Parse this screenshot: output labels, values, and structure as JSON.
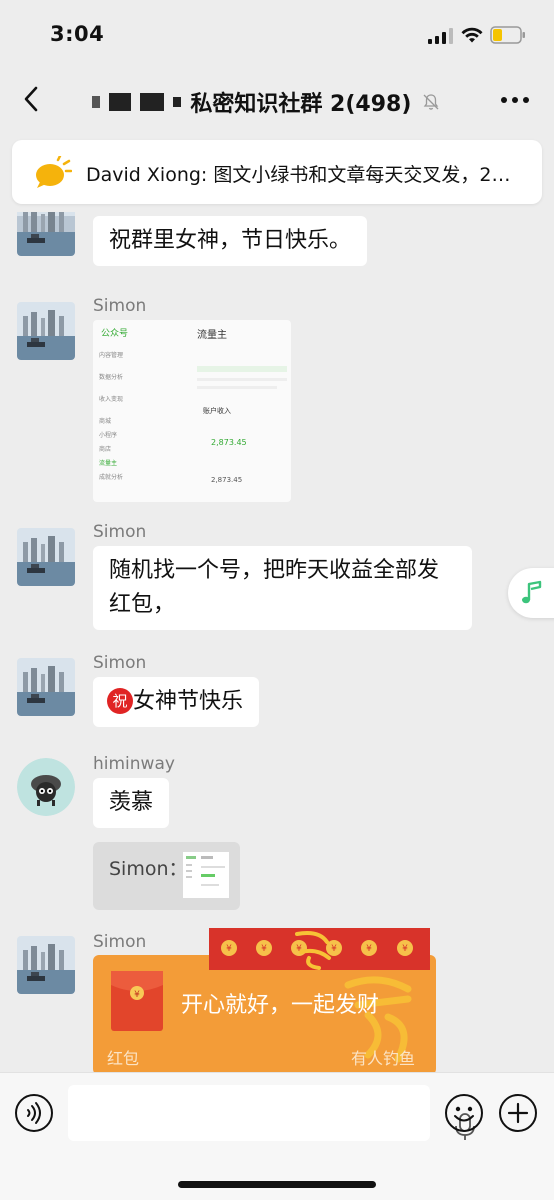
{
  "status_bar": {
    "time": "3:04"
  },
  "header": {
    "title": "私密知识社群 2(498)"
  },
  "notice": {
    "text": "David Xiong: 图文小绿书和文章每天交叉发，2…"
  },
  "messages": {
    "m1": {
      "text": "祝群里女神，节日快乐。"
    },
    "m2": {
      "sender": "Simon",
      "screenshot": {
        "app_name": "公众号",
        "tab": "流量主",
        "menu": [
          "内容管理",
          "数据分析",
          "收入变现",
          "商城",
          "小程序",
          "商店",
          "流量主",
          "成就分析"
        ],
        "section": "账户收入",
        "value1": "2,873.45",
        "value2": "2,873.45"
      }
    },
    "m3": {
      "sender": "Simon",
      "text": "随机找一个号，把昨天收益全部发红包，"
    },
    "m4": {
      "sender": "Simon",
      "emoji": "祝",
      "text": "女神节快乐"
    },
    "m5": {
      "sender": "himinway",
      "text": "羡慕",
      "quote_label": "Simon："
    },
    "m6": {
      "sender": "Simon",
      "red_packet": {
        "greeting": "开心就好，一起发财",
        "label": "红包",
        "status": "有人钓鱼"
      }
    }
  },
  "colors": {
    "red_packet": "#f39c38",
    "music_accent": "#3cc47c"
  }
}
